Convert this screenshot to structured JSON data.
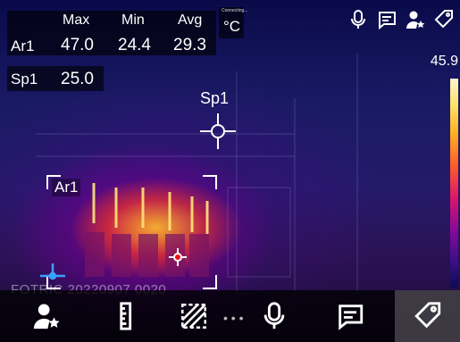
{
  "stats": {
    "headers": [
      "Max",
      "Min",
      "Avg"
    ],
    "ar1": {
      "label": "Ar1",
      "max": "47.0",
      "min": "24.4",
      "avg": "29.3"
    },
    "sp1": {
      "label": "Sp1",
      "value": "25.0"
    }
  },
  "status": {
    "connecting": "Connecting...",
    "unit": "°C"
  },
  "scale": {
    "max": "45.9"
  },
  "markers": {
    "sp1_label": "Sp1",
    "ar1_label": "Ar1"
  },
  "watermark": "FOTRIC 20220907 0020",
  "colors": {
    "accent_selected": "#ffffff",
    "palette": [
      "#fff6d0",
      "#ffe36b",
      "#ffb124",
      "#ff5a2a",
      "#d8146d",
      "#7d0a9a",
      "#0c0c52"
    ]
  },
  "top_icons": [
    "microphone-icon",
    "note-icon",
    "person-star-icon",
    "tag-icon"
  ],
  "bottom_buttons": [
    "person-star-icon",
    "ruler-icon",
    "area-hatch-icon",
    "microphone-icon",
    "note-icon",
    "tag-icon"
  ],
  "bottom_selected": "tag-icon"
}
